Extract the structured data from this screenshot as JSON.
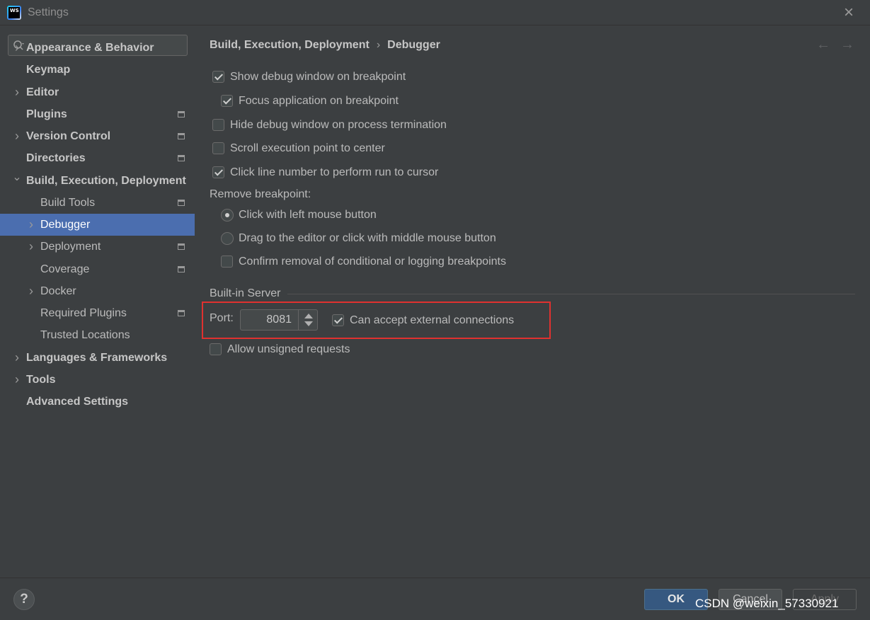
{
  "window": {
    "title": "Settings",
    "app_icon_text": "WS"
  },
  "sidebar": {
    "search": {
      "value": "",
      "placeholder": ""
    },
    "items": [
      {
        "label": "Appearance & Behavior",
        "expandable": true,
        "expanded": false,
        "bold": true,
        "project_scoped": false,
        "selected": false
      },
      {
        "label": "Keymap",
        "expandable": false,
        "bold": true,
        "project_scoped": false,
        "selected": false
      },
      {
        "label": "Editor",
        "expandable": true,
        "expanded": false,
        "bold": true,
        "project_scoped": false,
        "selected": false
      },
      {
        "label": "Plugins",
        "expandable": false,
        "bold": true,
        "project_scoped": true,
        "selected": false
      },
      {
        "label": "Version Control",
        "expandable": true,
        "expanded": false,
        "bold": true,
        "project_scoped": true,
        "selected": false
      },
      {
        "label": "Directories",
        "expandable": false,
        "bold": true,
        "project_scoped": true,
        "selected": false
      },
      {
        "label": "Build, Execution, Deployment",
        "expandable": true,
        "expanded": true,
        "bold": true,
        "project_scoped": false,
        "selected": false
      },
      {
        "label": "Build Tools",
        "expandable": false,
        "bold": false,
        "project_scoped": true,
        "selected": false
      },
      {
        "label": "Debugger",
        "expandable": true,
        "expanded": false,
        "bold": false,
        "project_scoped": false,
        "selected": true
      },
      {
        "label": "Deployment",
        "expandable": true,
        "expanded": false,
        "bold": false,
        "project_scoped": true,
        "selected": false
      },
      {
        "label": "Coverage",
        "expandable": false,
        "bold": false,
        "project_scoped": true,
        "selected": false
      },
      {
        "label": "Docker",
        "expandable": true,
        "expanded": false,
        "bold": false,
        "project_scoped": false,
        "selected": false
      },
      {
        "label": "Required Plugins",
        "expandable": false,
        "bold": false,
        "project_scoped": true,
        "selected": false
      },
      {
        "label": "Trusted Locations",
        "expandable": false,
        "bold": false,
        "project_scoped": false,
        "selected": false
      },
      {
        "label": "Languages & Frameworks",
        "expandable": true,
        "expanded": false,
        "bold": true,
        "project_scoped": false,
        "selected": false
      },
      {
        "label": "Tools",
        "expandable": true,
        "expanded": false,
        "bold": true,
        "project_scoped": false,
        "selected": false
      },
      {
        "label": "Advanced Settings",
        "expandable": false,
        "bold": true,
        "project_scoped": false,
        "selected": false
      }
    ]
  },
  "breadcrumb": {
    "parent": "Build, Execution, Deployment",
    "separator": "›",
    "current": "Debugger"
  },
  "nav": {
    "back_icon": "arrow-left-icon",
    "forward_icon": "arrow-right-icon"
  },
  "options": {
    "show_debug_window": {
      "label": "Show debug window on breakpoint",
      "checked": true
    },
    "focus_application": {
      "label": "Focus application on breakpoint",
      "checked": true
    },
    "hide_debug_window": {
      "label": "Hide debug window on process termination",
      "checked": false
    },
    "scroll_execution": {
      "label": "Scroll execution point to center",
      "checked": false
    },
    "click_line_number": {
      "label": "Click line number to perform run to cursor",
      "checked": true
    }
  },
  "remove_breakpoint": {
    "heading": "Remove breakpoint:",
    "choices": [
      {
        "label": "Click with left mouse button",
        "selected": true
      },
      {
        "label": "Drag to the editor or click with middle mouse button",
        "selected": false
      }
    ],
    "confirm_removal": {
      "label": "Confirm removal of conditional or logging breakpoints",
      "checked": false
    }
  },
  "builtin_server": {
    "heading": "Built-in Server",
    "port_label": "Port:",
    "port_value": "8081",
    "accept_external": {
      "label": "Can accept external connections",
      "checked": true
    },
    "allow_unsigned": {
      "label": "Allow unsigned requests",
      "checked": false
    }
  },
  "footer": {
    "help_label": "?",
    "ok_label": "OK",
    "cancel_label": "Cancel",
    "apply_label": "Apply",
    "watermark": "CSDN @weixin_57330921"
  },
  "colors": {
    "background": "#3c3f41",
    "selection": "#4b6eaf",
    "highlight_border": "#e0312f",
    "ok_button": "#365880"
  }
}
